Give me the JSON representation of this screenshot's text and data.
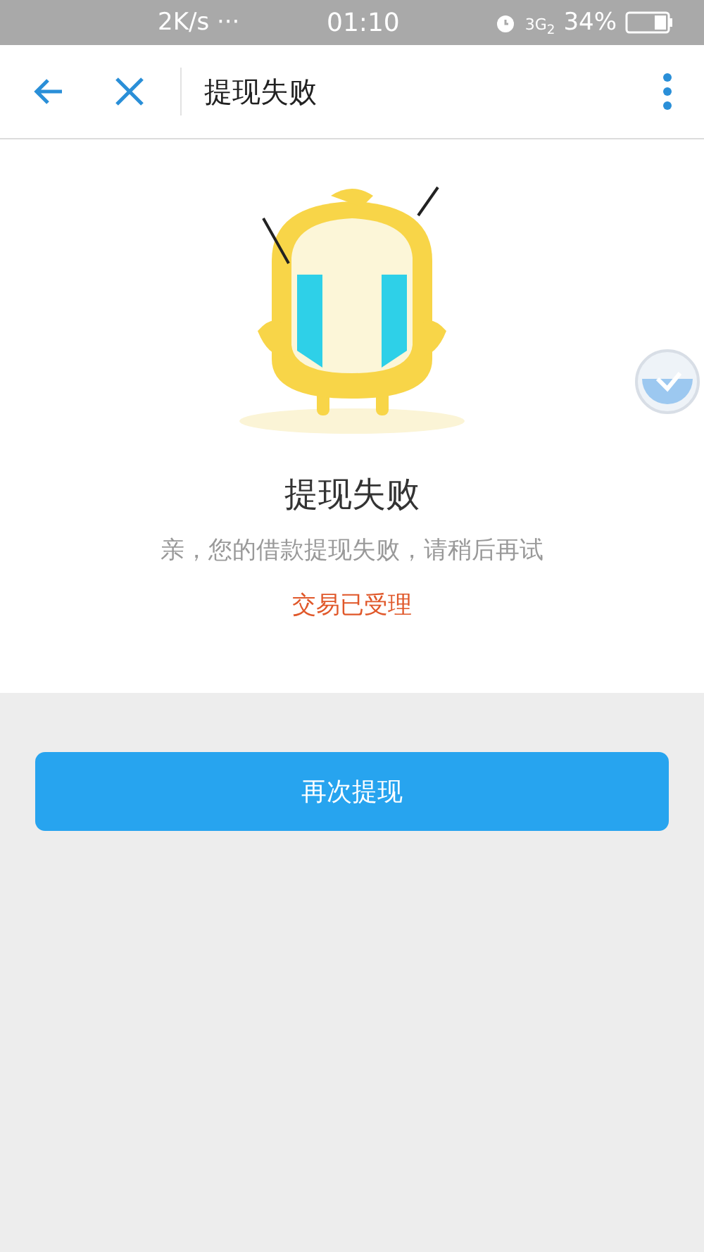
{
  "status_bar": {
    "speed": "2K/s ···",
    "time": "01:10",
    "network": "3G",
    "network_sub": "2",
    "battery": "34%"
  },
  "nav_bar": {
    "title": "提现失败"
  },
  "result": {
    "title": "提现失败",
    "message": "亲，您的借款提现失败，请稍后再试",
    "status": "交易已受理"
  },
  "button": {
    "label": "再次提现"
  }
}
